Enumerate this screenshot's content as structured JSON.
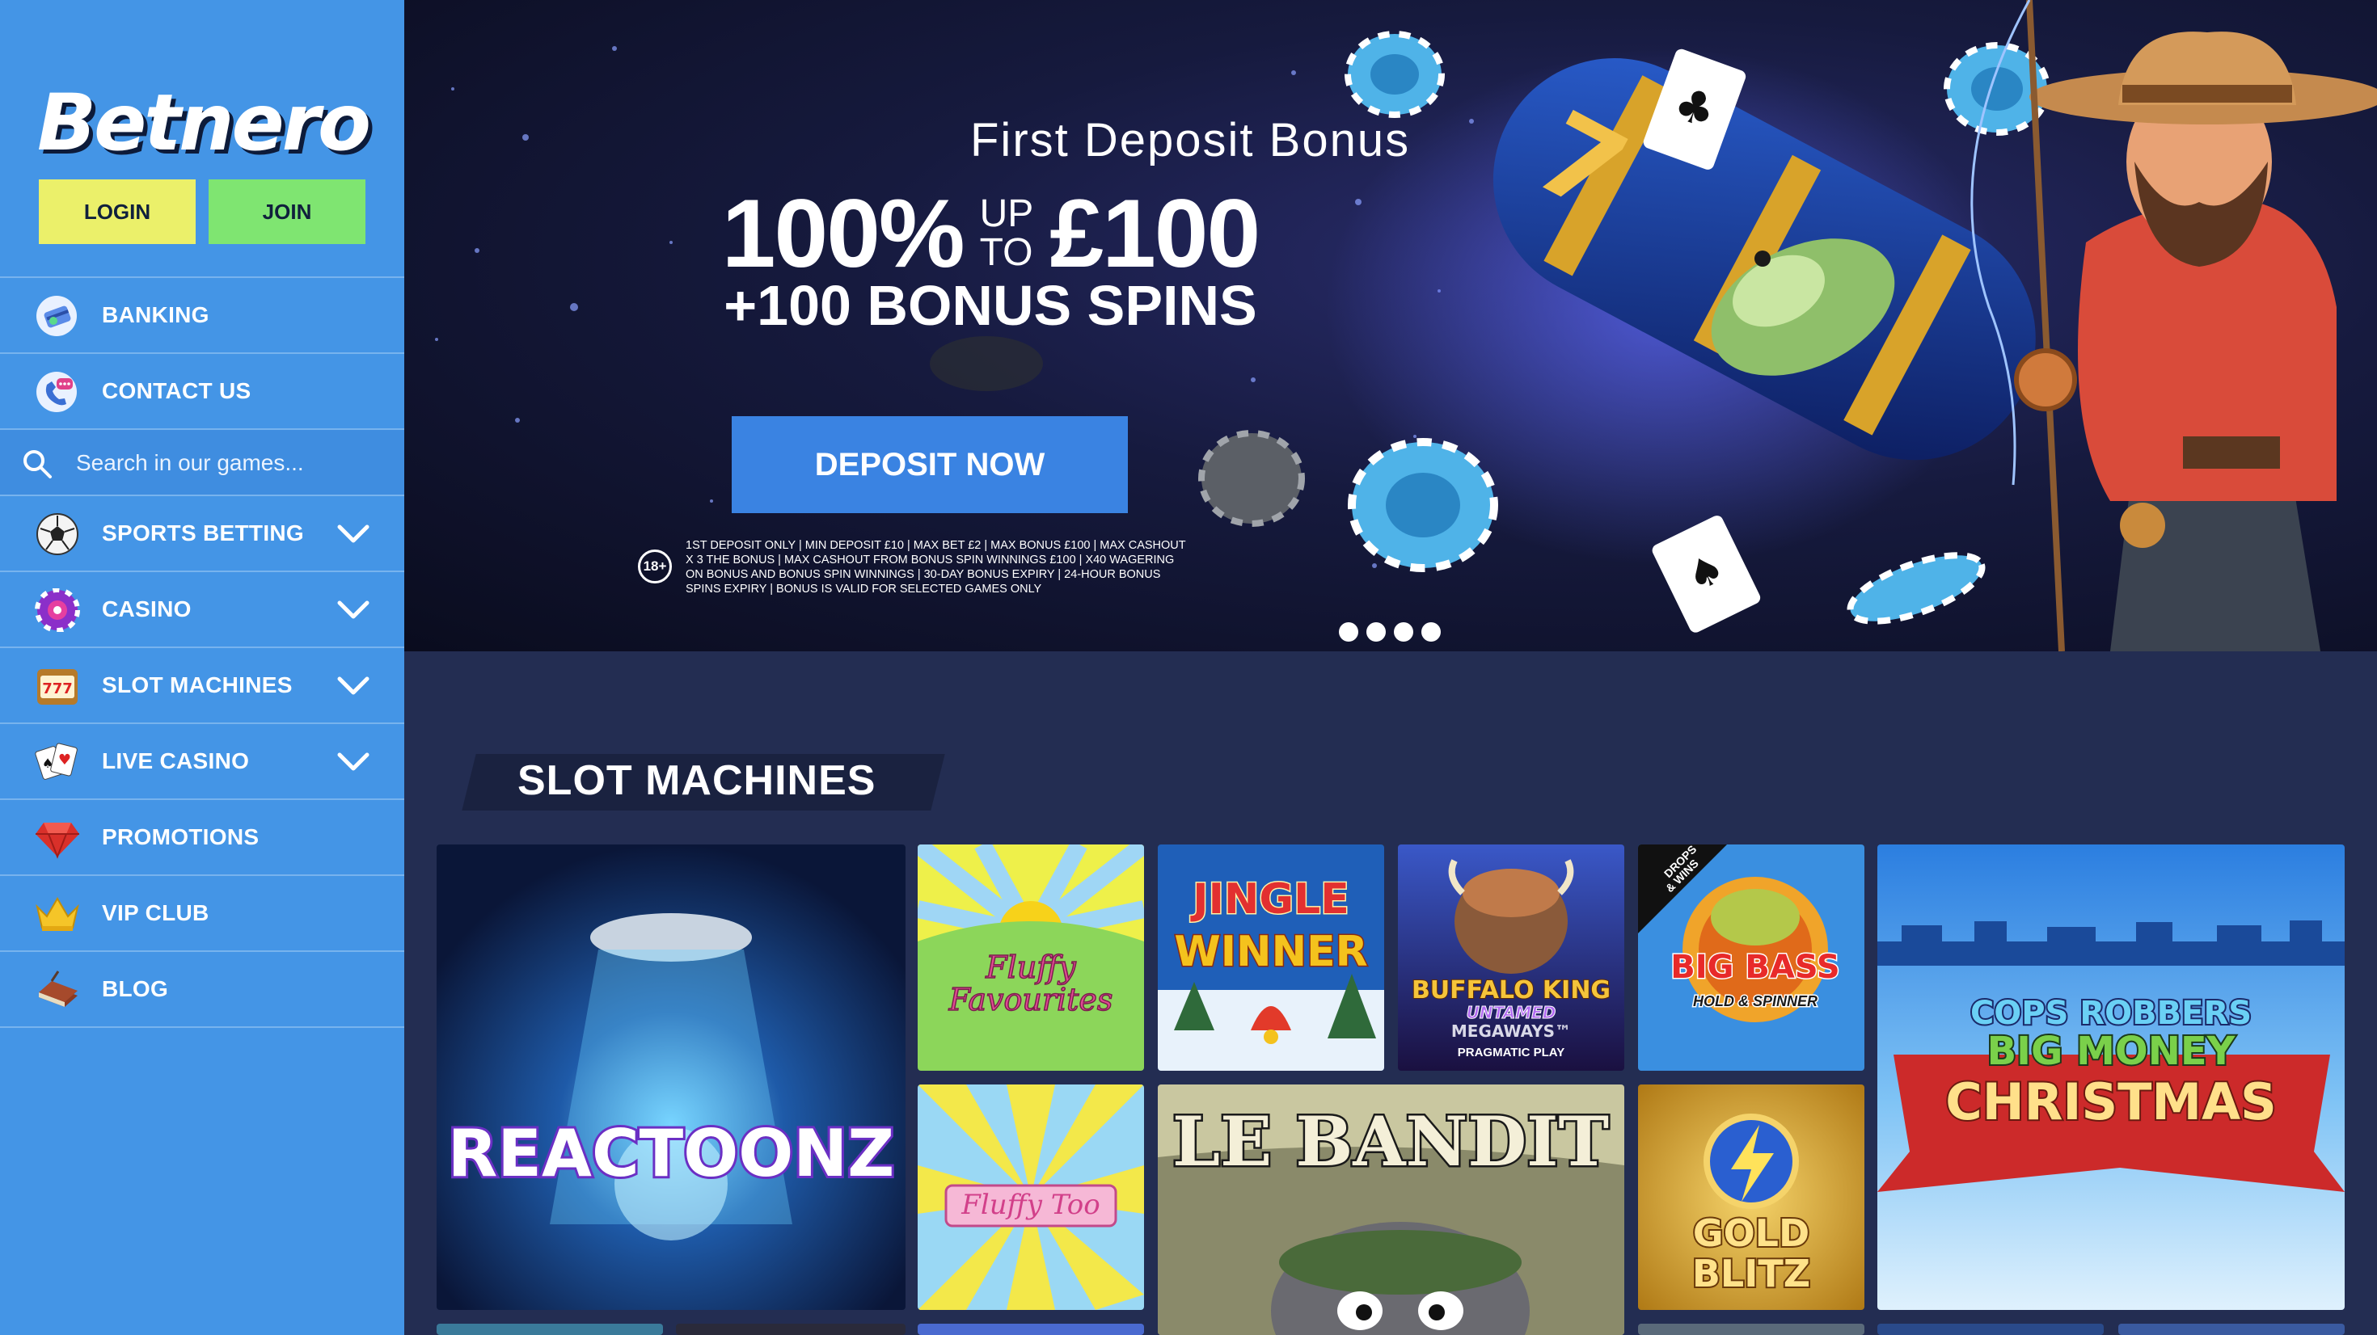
{
  "sidebar": {
    "logo": "Betnero",
    "auth": {
      "login": "LOGIN",
      "join": "JOIN"
    },
    "search_placeholder": "Search in our games...",
    "items": {
      "banking": "BANKING",
      "contact": "CONTACT US",
      "sports": "SPORTS BETTING",
      "casino": "CASINO",
      "slots": "SLOT MACHINES",
      "live": "LIVE CASINO",
      "promotions": "PROMOTIONS",
      "vip": "VIP CLUB",
      "blog": "BLOG"
    },
    "icons": {
      "banking": "banking-icon",
      "contact": "contact-icon",
      "search": "search-icon",
      "sports": "soccer-ball-icon",
      "casino": "casino-chip-icon",
      "slots": "slot-machine-icon",
      "live": "playing-cards-icon",
      "promotions": "gem-icon",
      "vip": "crown-icon",
      "blog": "book-icon",
      "chevron": "chevron-down-icon"
    }
  },
  "hero": {
    "subtitle": "First Deposit Bonus",
    "percent": "100%",
    "up": "UP",
    "to": "TO",
    "amount": "£100",
    "spins": "+100 BONUS SPINS",
    "cta": "DEPOSIT NOW",
    "age": "18+",
    "terms": "1ST DEPOSIT ONLY | MIN DEPOSIT £10 | MAX BET £2 | MAX BONUS £100 | MAX CASHOUT X 3 THE BONUS | MAX CASHOUT FROM BONUS SPIN WINNINGS £100 | X40 WAGERING ON BONUS AND BONUS SPIN WINNINGS | 30-DAY BONUS EXPIRY | 24-HOUR BONUS SPINS EXPIRY | BONUS IS VALID FOR SELECTED GAMES ONLY",
    "slides": 4
  },
  "section": {
    "title": "SLOT MACHINES",
    "games": {
      "reactoonz": "REACTOONZ",
      "fluffy_fav_1": "Fluffy",
      "fluffy_fav_2": "Favourites",
      "jingle_1": "JINGLE",
      "jingle_2": "WINNER",
      "buffalo_1": "BUFFALO KING",
      "buffalo_2": "UNTAMED",
      "buffalo_3": "MEGAWAYS™",
      "buffalo_4": "PRAGMATIC PLAY",
      "bigbass_tag_1": "DROPS",
      "bigbass_tag_2": "& WINS",
      "bigbass_1": "BIG BASS",
      "bigbass_2": "HOLD & SPINNER",
      "cops_1": "COPS ROBBERS",
      "cops_2": "BIG MONEY",
      "cops_3": "CHRISTMAS",
      "fluffy_too": "Fluffy Too",
      "lebandit": "LE BANDIT",
      "goldblitz_1": "GOLD",
      "goldblitz_2": "BLITZ"
    }
  },
  "colors": {
    "sidebar": "#4495e6",
    "login": "#ebf06a",
    "join": "#7fe571",
    "cta": "#3a83e2",
    "page_bg": "#232d52"
  }
}
